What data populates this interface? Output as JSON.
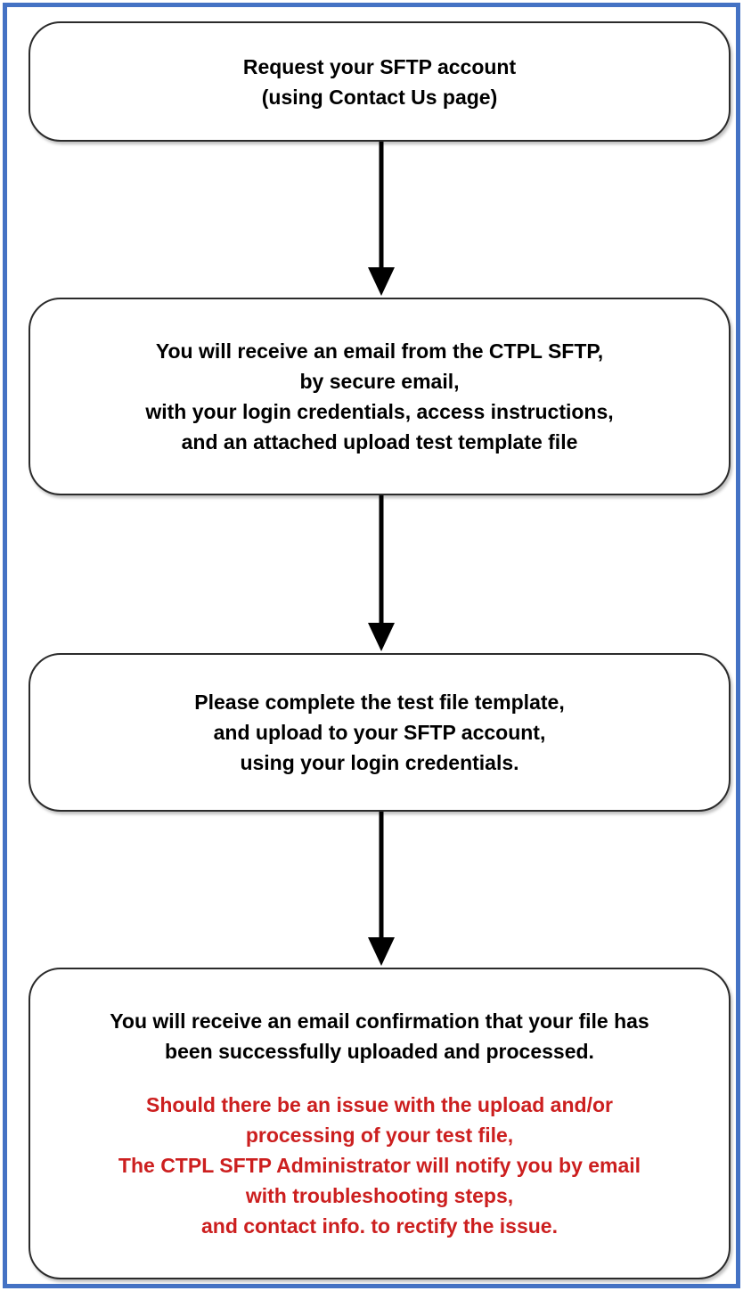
{
  "steps": [
    {
      "lines": [
        "Request your SFTP account",
        "(using Contact Us page)"
      ]
    },
    {
      "lines": [
        "You will receive an email from the CTPL SFTP,",
        "by secure email,",
        "with your login credentials, access instructions,",
        "and an attached upload test template file"
      ]
    },
    {
      "lines": [
        "Please complete the test file template,",
        "and upload to your SFTP account,",
        "using your login credentials."
      ]
    },
    {
      "lines": [
        "You will receive an email confirmation that your file has",
        "been successfully uploaded and processed."
      ],
      "warning_lines": [
        "Should there be an issue with the upload and/or",
        "processing of your test file,",
        "The CTPL SFTP Administrator will notify you by email",
        "with troubleshooting steps,",
        "and contact info. to rectify the issue."
      ]
    }
  ],
  "colors": {
    "frame_border": "#4472c4",
    "box_border": "#2b2b2b",
    "text": "#000000",
    "warning_text": "#cc1f1f",
    "arrow": "#000000"
  }
}
